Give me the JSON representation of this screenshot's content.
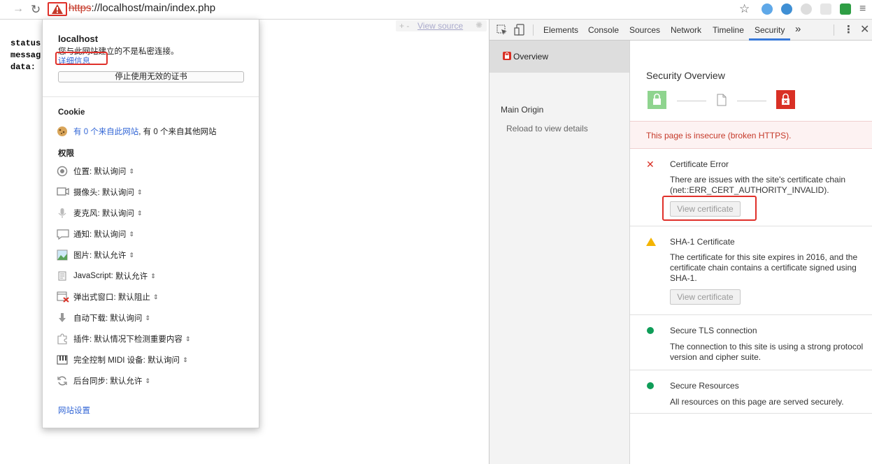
{
  "browser": {
    "url_scheme": "https",
    "url_rest": "://localhost/main/index.php"
  },
  "page": {
    "lines": [
      "status",
      "messag",
      "data:"
    ],
    "view_source_plus": "+ -",
    "view_source": "View source"
  },
  "popup": {
    "host": "localhost",
    "warning": "您与此网站建立的不是私密连接。",
    "details_link": "详细信息",
    "stop_button": "停止使用无效的证书",
    "cookie_heading": "Cookie",
    "cookie_text_link": "有 0 个来自此网站",
    "cookie_text_rest": ", 有 0 个来自其他网站",
    "permissions_heading": "权限",
    "permissions": [
      {
        "label": "位置:",
        "value": "默认询问",
        "icon": "location-icon"
      },
      {
        "label": "摄像头:",
        "value": "默认询问",
        "icon": "camera-icon"
      },
      {
        "label": "麦克风:",
        "value": "默认询问",
        "icon": "microphone-icon"
      },
      {
        "label": "通知:",
        "value": "默认询问",
        "icon": "notification-icon"
      },
      {
        "label": "图片:",
        "value": "默认允许",
        "icon": "image-icon"
      },
      {
        "label": "JavaScript:",
        "value": "默认允许",
        "icon": "javascript-icon"
      },
      {
        "label": "弹出式窗口:",
        "value": "默认阻止",
        "icon": "popup-blocked-icon"
      },
      {
        "label": "自动下载:",
        "value": "默认询问",
        "icon": "download-icon"
      },
      {
        "label": "插件:",
        "value": "默认情况下检测重要内容",
        "icon": "plugin-icon"
      },
      {
        "label": "完全控制 MIDI 设备:",
        "value": "默认询问",
        "icon": "midi-icon"
      },
      {
        "label": "后台同步:",
        "value": "默认允许",
        "icon": "sync-icon"
      }
    ],
    "site_settings": "网站设置"
  },
  "devtools": {
    "tabs": [
      "Elements",
      "Console",
      "Sources",
      "Network",
      "Timeline",
      "Security"
    ],
    "active_tab": "Security",
    "more": "»",
    "sidebar": {
      "overview": "Overview",
      "main_origin": "Main Origin",
      "reload_hint": "Reload to view details"
    },
    "overview_title": "Security Overview",
    "insecure_banner": "This page is insecure (broken HTTPS).",
    "sections": [
      {
        "title": "Certificate Error",
        "body": "There are issues with the site's certificate chain (net::ERR_CERT_AUTHORITY_INVALID).",
        "button": "View certificate",
        "status": "error"
      },
      {
        "title": "SHA-1 Certificate",
        "body": "The certificate for this site expires in 2016, and the certificate chain contains a certificate signed using SHA-1.",
        "button": "View certificate",
        "status": "warning"
      },
      {
        "title": "Secure TLS connection",
        "body": "The connection to this site is using a strong protocol version and cipher suite.",
        "status": "secure"
      },
      {
        "title": "Secure Resources",
        "body": "All resources on this page are served securely.",
        "status": "secure"
      }
    ],
    "colors": {
      "error": "#d93025",
      "warning": "#f4b400",
      "secure": "#0f9d58",
      "banner_bg": "#fdf2f2",
      "banner_text": "#c53929"
    }
  }
}
